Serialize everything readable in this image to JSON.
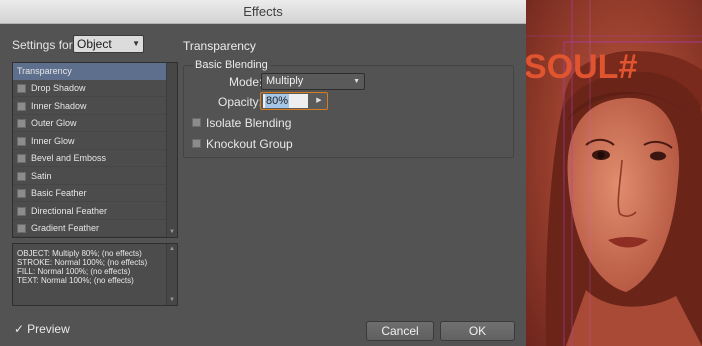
{
  "window": {
    "title": "Effects"
  },
  "settings": {
    "label": "Settings for:",
    "selected": "Object"
  },
  "section": {
    "title": "Transparency"
  },
  "effects": [
    {
      "label": "Transparency",
      "selected": true
    },
    {
      "label": "Drop Shadow"
    },
    {
      "label": "Inner Shadow"
    },
    {
      "label": "Outer Glow"
    },
    {
      "label": "Inner Glow"
    },
    {
      "label": "Bevel and Emboss"
    },
    {
      "label": "Satin"
    },
    {
      "label": "Basic Feather"
    },
    {
      "label": "Directional Feather"
    },
    {
      "label": "Gradient Feather"
    }
  ],
  "summary": [
    "OBJECT: Multiply 80%; (no effects)",
    "STROKE: Normal 100%; (no effects)",
    "FILL: Normal 100%; (no effects)",
    "TEXT: Normal 100%; (no effects)"
  ],
  "basic_blending": {
    "label": "Basic Blending",
    "mode_label": "Mode:",
    "mode_value": "Multiply",
    "opacity_label": "Opacity:",
    "opacity_value": "80%"
  },
  "options": {
    "isolate_blending": "Isolate Blending",
    "knockout_group": "Knockout Group"
  },
  "footer": {
    "preview_label": "Preview",
    "cancel_label": "Cancel",
    "ok_label": "OK"
  },
  "artwork": {
    "headline": "SOUL#",
    "accent": "#e0542f"
  }
}
